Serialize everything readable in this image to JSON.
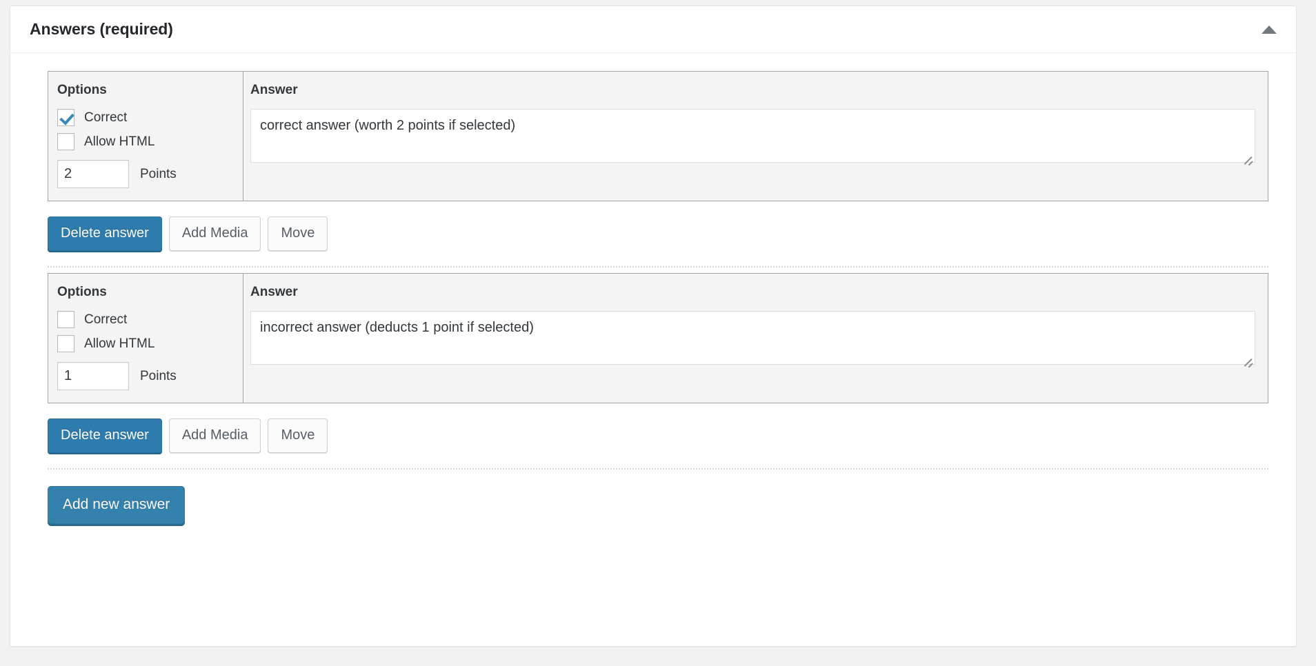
{
  "panel": {
    "title": "Answers (required)",
    "toggle_icon": "triangle-up-icon"
  },
  "columns": {
    "options_heading": "Options",
    "answer_heading": "Answer"
  },
  "labels": {
    "correct": "Correct",
    "allow_html": "Allow HTML",
    "points": "Points"
  },
  "buttons": {
    "delete_answer": "Delete answer",
    "add_media": "Add Media",
    "move": "Move",
    "add_new_answer": "Add new answer"
  },
  "colors": {
    "primary_blue": "#2e7cad",
    "checkbox_check": "#3a87b8",
    "panel_background": "#ffffff",
    "page_background": "#f1f1f1",
    "table_background": "#f4f4f4",
    "table_border": "#a0a5aa"
  },
  "answers": [
    {
      "correct_checked": true,
      "allow_html_checked": false,
      "points": "2",
      "text": "correct answer (worth 2 points if selected)"
    },
    {
      "correct_checked": false,
      "allow_html_checked": false,
      "points": "1",
      "text": "incorrect answer (deducts 1 point if selected)"
    }
  ]
}
